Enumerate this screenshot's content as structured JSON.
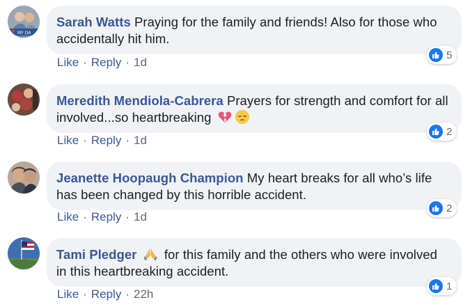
{
  "comments": [
    {
      "author": "Sarah Watts",
      "text": "Praying for the family and friends! Also for those who accidentally hit him.",
      "reaction_count": "5",
      "actions": {
        "like": "Like",
        "reply": "Reply",
        "time": "1d"
      },
      "avatar_caption": "MY DA"
    },
    {
      "author": "Meredith Mendiola-Cabrera",
      "text": "Prayers for strength and comfort for all involved...so heartbreaking",
      "reaction_count": "2",
      "actions": {
        "like": "Like",
        "reply": "Reply",
        "time": "1d"
      },
      "emojis": [
        "broken-heart-icon",
        "pensive-face-icon"
      ]
    },
    {
      "author": "Jeanette Hoopaugh Champion",
      "text": "My heart breaks for all who’s life has been changed by this horrible accident.",
      "reaction_count": "2",
      "actions": {
        "like": "Like",
        "reply": "Reply",
        "time": "1d"
      }
    },
    {
      "author": "Tami Pledger",
      "text": "for this family and the others who were involved in this heartbreaking accident.",
      "reaction_count": "1",
      "actions": {
        "like": "Like",
        "reply": "Reply",
        "time": "22h"
      },
      "emojis": [
        "folded-hands-icon"
      ]
    }
  ],
  "separator": "·",
  "colors": {
    "author": "#385898",
    "bubble": "#f0f2f5",
    "like_badge": "#1877f2",
    "meta": "#606770"
  }
}
